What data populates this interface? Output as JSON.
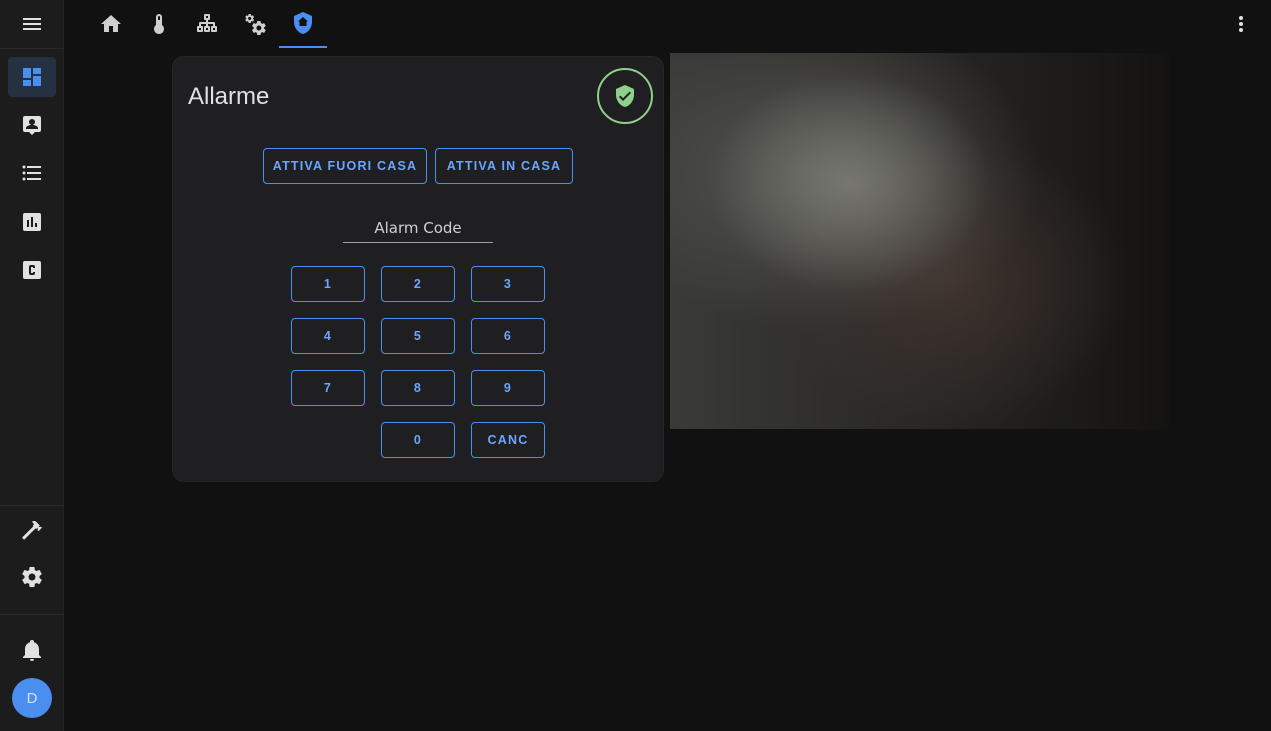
{
  "sidebar": {
    "items": [
      {
        "name": "overview",
        "icon": "dashboard-icon",
        "active": true
      },
      {
        "name": "map",
        "icon": "account-box-icon",
        "active": false
      },
      {
        "name": "logbook",
        "icon": "list-icon",
        "active": false
      },
      {
        "name": "history",
        "icon": "chart-box-icon",
        "active": false
      },
      {
        "name": "custom",
        "icon": "c-box-icon",
        "active": false
      }
    ],
    "bottom_items": [
      {
        "name": "developer-tools",
        "icon": "hammer-icon"
      },
      {
        "name": "settings",
        "icon": "gear-icon"
      },
      {
        "name": "notifications",
        "icon": "bell-icon"
      }
    ],
    "avatar_initial": "D"
  },
  "toolbar": {
    "tabs": [
      {
        "name": "home",
        "icon": "home-icon",
        "active": false
      },
      {
        "name": "climate",
        "icon": "thermometer-icon",
        "active": false
      },
      {
        "name": "network",
        "icon": "network-icon",
        "active": false
      },
      {
        "name": "cogs",
        "icon": "cogs-icon",
        "active": false
      },
      {
        "name": "security",
        "icon": "shield-home-icon",
        "active": true
      }
    ]
  },
  "alarm_card": {
    "title": "Allarme",
    "state_icon": "shield-check-icon",
    "arm_away_label": "ATTIVA FUORI CASA",
    "arm_home_label": "ATTIVA IN CASA",
    "code_placeholder": "Alarm Code",
    "keypad": [
      "1",
      "2",
      "3",
      "4",
      "5",
      "6",
      "7",
      "8",
      "9",
      "0"
    ],
    "clear_label": "CANC"
  },
  "colors": {
    "accent": "#4a8ff0",
    "state_disarmed": "#8fd08a",
    "background": "#111111",
    "card": "#1f1f22"
  }
}
